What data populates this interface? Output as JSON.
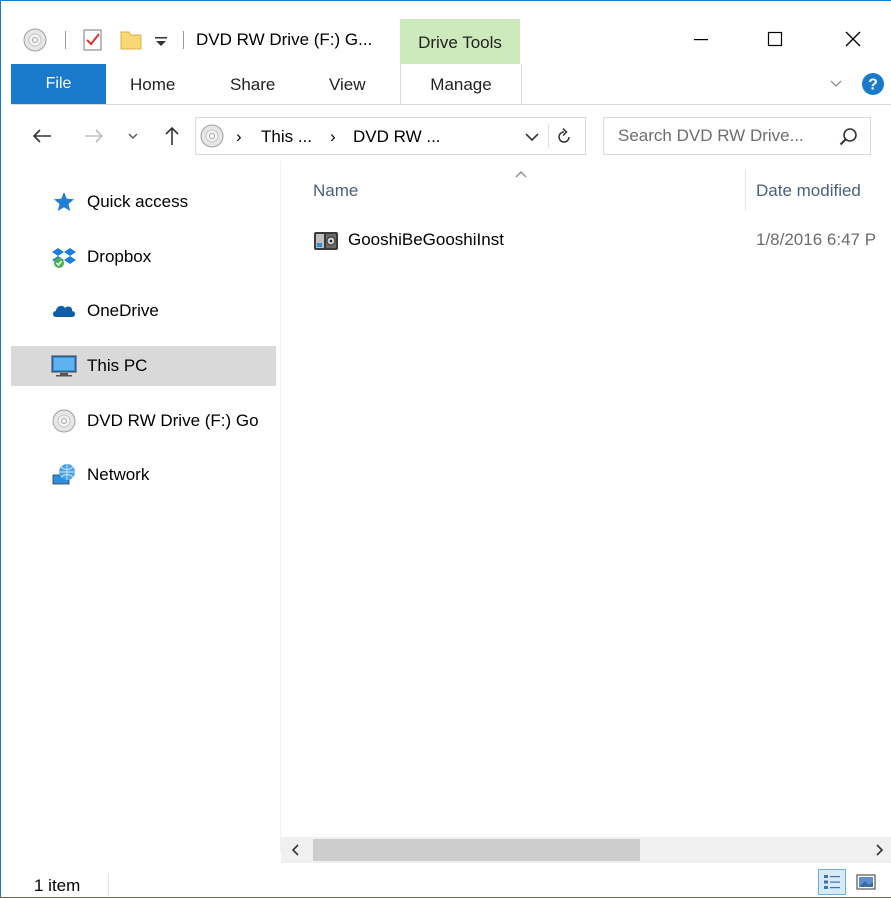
{
  "window": {
    "title": "DVD RW Drive (F:) G...",
    "context_tab": "Drive Tools"
  },
  "ribbon": {
    "tabs": [
      {
        "label": "File"
      },
      {
        "label": "Home"
      },
      {
        "label": "Share"
      },
      {
        "label": "View"
      },
      {
        "label": "Manage"
      }
    ]
  },
  "address": {
    "segments": [
      "This ...",
      "DVD RW ..."
    ],
    "separator": "›"
  },
  "search": {
    "placeholder": "Search DVD RW Drive..."
  },
  "nav": {
    "items": [
      {
        "label": "Quick access",
        "icon": "star-icon"
      },
      {
        "label": "Dropbox",
        "icon": "dropbox-icon"
      },
      {
        "label": "OneDrive",
        "icon": "onedrive-icon"
      },
      {
        "label": "This PC",
        "icon": "computer-icon",
        "selected": true
      },
      {
        "label": "DVD RW Drive (F:) Go",
        "icon": "dvd-icon"
      },
      {
        "label": "Network",
        "icon": "network-icon"
      }
    ]
  },
  "columns": {
    "name": "Name",
    "date_modified": "Date modified"
  },
  "files": [
    {
      "name": "GooshiBeGooshiInst",
      "date": "1/8/2016 6:47 P"
    }
  ],
  "status": {
    "count": "1 item"
  },
  "colors": {
    "accent": "#1979ca",
    "context_tab": "#cdeabc",
    "selection": "#d9d9d9"
  }
}
